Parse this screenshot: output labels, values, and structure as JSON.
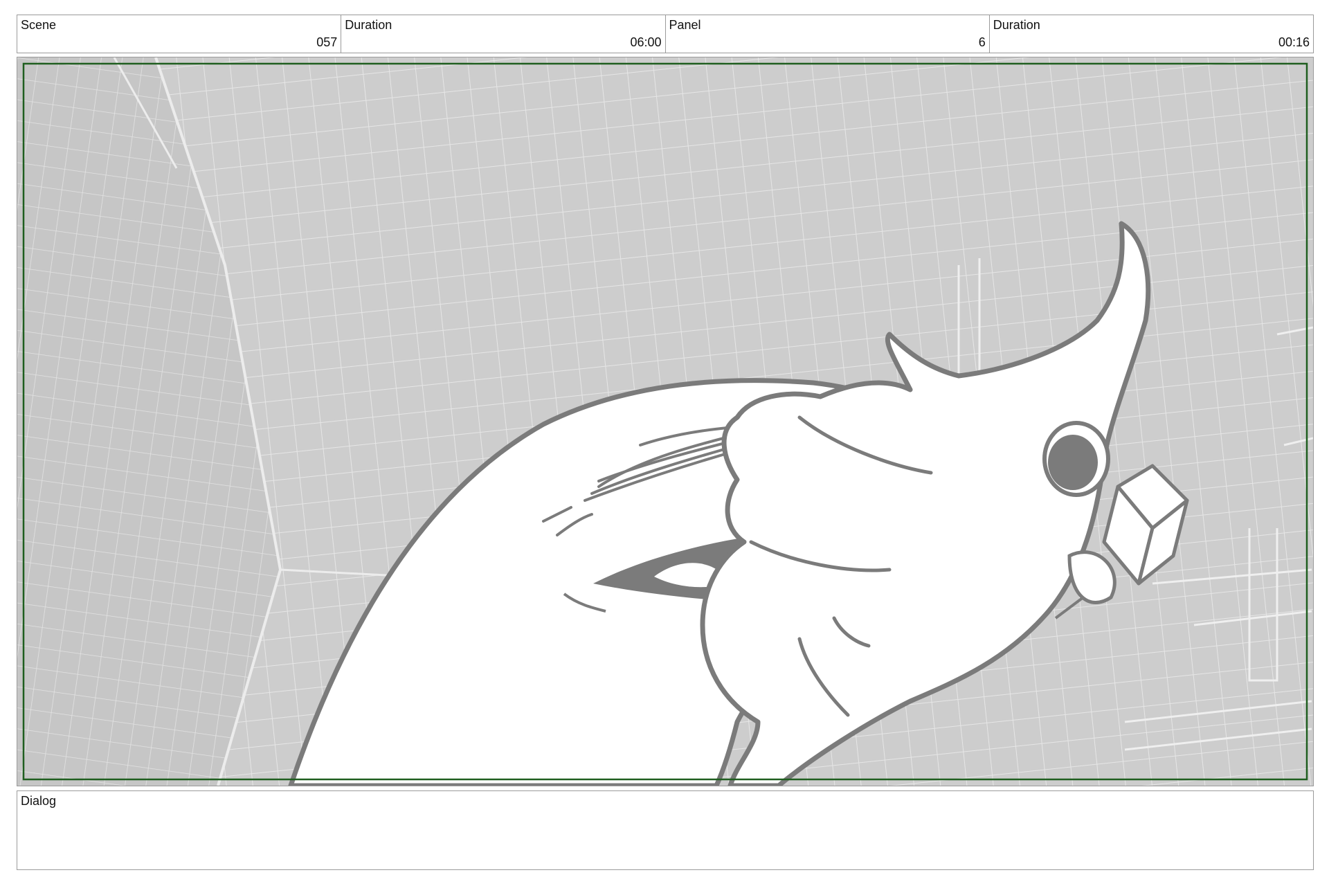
{
  "header": {
    "scene_label": "Scene",
    "scene_value": "057",
    "scene_duration_label": "Duration",
    "scene_duration_value": "06:00",
    "panel_label": "Panel",
    "panel_value": "6",
    "panel_duration_label": "Duration",
    "panel_duration_value": "00:16"
  },
  "dialog": {
    "label": "Dialog"
  },
  "colors": {
    "frame_border": "#1f5e1f",
    "background": "#cdcdcd",
    "line": "#7b7b7b"
  }
}
